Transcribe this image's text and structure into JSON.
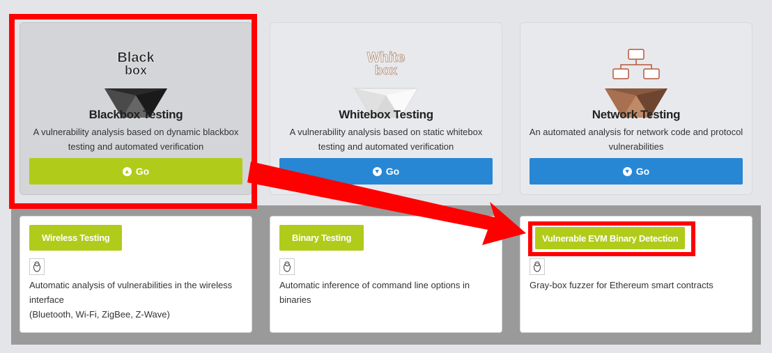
{
  "top_cards": [
    {
      "icon": "blackbox-icon",
      "icon_text": [
        "Black",
        "box"
      ],
      "title": "Blackbox Testing",
      "desc_line1": "A vulnerability analysis based on dynamic blackbox",
      "desc_line2": "testing and automated verification",
      "button_label": "Go",
      "button_color": "#b1cb1b"
    },
    {
      "icon": "whitebox-icon",
      "icon_text": [
        "White",
        "box"
      ],
      "title": "Whitebox Testing",
      "desc_line1": "A vulnerability analysis based on static whitebox",
      "desc_line2": "testing and automated verification",
      "button_label": "Go",
      "button_color": "#2887d4"
    },
    {
      "icon": "network-icon",
      "title": "Network Testing",
      "desc_line1": "An automated analysis for network code and protocol",
      "desc_line2": "vulnerabilities",
      "button_label": "Go",
      "button_color": "#2887d4"
    }
  ],
  "bottom_cards": [
    {
      "tag": "Wireless Testing",
      "icon": "linux-icon",
      "desc_line1": "Automatic analysis of vulnerabilities in the wireless",
      "desc_line2": "interface",
      "desc_line3": "(Bluetooth, Wi-Fi, ZigBee, Z-Wave)"
    },
    {
      "tag": "Binary Testing",
      "icon": "linux-icon",
      "desc_line1": "Automatic inference of command line options in",
      "desc_line2": "binaries"
    },
    {
      "tag": "Vulnerable EVM Binary Detection",
      "icon": "linux-icon",
      "desc_line1": "Gray-box fuzzer for Ethereum smart contracts"
    }
  ],
  "colors": {
    "accent_green": "#b1cb1b",
    "accent_blue": "#2887d4",
    "annotation_red": "#ff0000"
  }
}
